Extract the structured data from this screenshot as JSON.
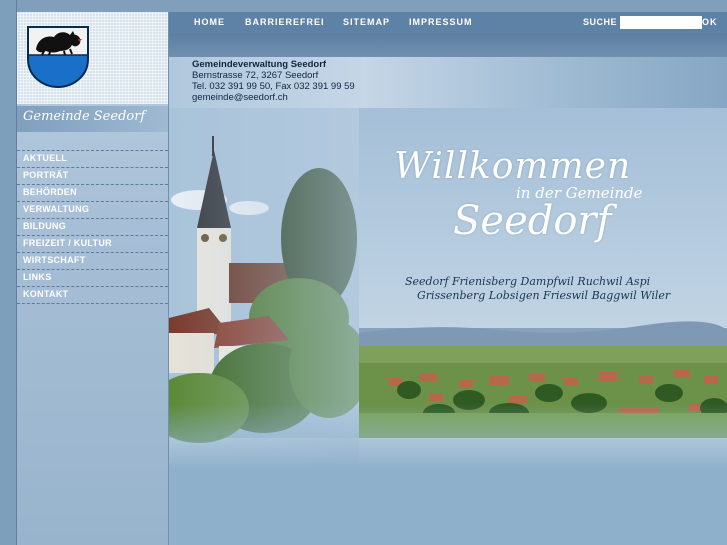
{
  "nav_top": {
    "items": [
      {
        "label": "HOME"
      },
      {
        "label": "BARRIEREFREI"
      },
      {
        "label": "SITEMAP"
      },
      {
        "label": "IMPRESSUM"
      }
    ],
    "search_label": "SUCHE",
    "search_value": "",
    "search_button": "OK"
  },
  "site": {
    "name": "Gemeinde Seedorf",
    "coat_of_arms_icon": "bear-coat-of-arms-icon"
  },
  "address": {
    "name": "Gemeindeverwaltung Seedorf",
    "street": "Bernstrasse 72, 3267 Seedorf",
    "phone": "Tel. 032 391 99 50, Fax 032 391 99 59",
    "email": "gemeinde@seedorf.ch"
  },
  "sidebar": {
    "items": [
      {
        "label": "AKTUELL"
      },
      {
        "label": "PORTRÄT"
      },
      {
        "label": "BEHÖRDEN"
      },
      {
        "label": "VERWALTUNG"
      },
      {
        "label": "BILDUNG"
      },
      {
        "label": "FREIZEIT / KULTUR"
      },
      {
        "label": "WIRTSCHAFT"
      },
      {
        "label": "LINKS"
      },
      {
        "label": "KONTAKT"
      }
    ]
  },
  "hero": {
    "welcome": "Willkommen",
    "subtitle": "in der Gemeinde",
    "town": "Seedorf",
    "villages_line1": "Seedorf  Frienisberg  Dampfwil  Ruchwil  Aspi",
    "villages_line2": "Grissenberg  Lobsigen  Frieswil  Baggwil  Wiler"
  },
  "colors": {
    "topbar": "#5d82a6",
    "background": "#8eb0cb",
    "accent_text": "#0f2642"
  }
}
